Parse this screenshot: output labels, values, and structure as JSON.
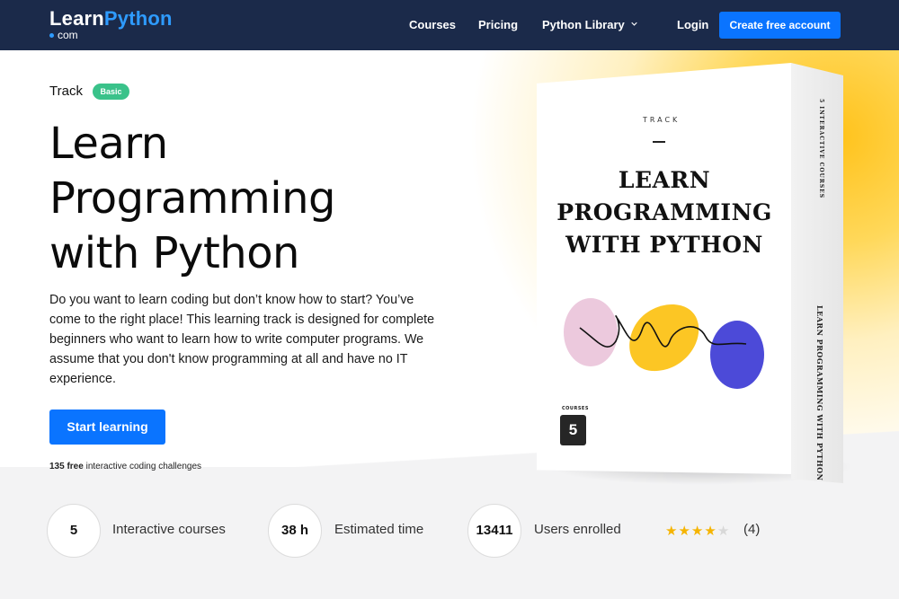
{
  "nav": {
    "logo_main": "Learn",
    "logo_accent": "Python",
    "logo_sub": "com",
    "links": [
      "Courses",
      "Pricing",
      "Python Library"
    ],
    "login": "Login",
    "cta": "Create free account",
    "colors": {
      "bar": "#1b2a4a",
      "accent": "#0a74ff"
    }
  },
  "hero": {
    "track_label": "Track",
    "badge": "Basic",
    "title_lines": [
      "Learn",
      "Programming",
      "with Python"
    ],
    "description": "Do you want to learn coding but don’t know how to start? You’ve come to the right place! This learning track is designed for complete beginners who want to learn how to write computer programs. We assume that you don't know programming at all and have no IT experience.",
    "start_button": "Start learning",
    "challenges_count": "135 free",
    "challenges_text": " interactive coding challenges"
  },
  "box": {
    "track": "TRACK",
    "title_lines": [
      "LEARN",
      "PROGRAMMING",
      "WITH PYTHON"
    ],
    "courses_label": "COURSES",
    "courses_count": "5",
    "side_top": "5 INTERACTIVE COURSES",
    "side_bottom": "LEARN PROGRAMMING WITH PYTHON"
  },
  "stats": [
    {
      "value": "5",
      "label": "Interactive courses"
    },
    {
      "value": "38 h",
      "label": "Estimated time"
    },
    {
      "value": "13411",
      "label": "Users enrolled"
    }
  ],
  "rating": {
    "stars_filled": 4,
    "stars_total": 5,
    "count": "(4)"
  }
}
